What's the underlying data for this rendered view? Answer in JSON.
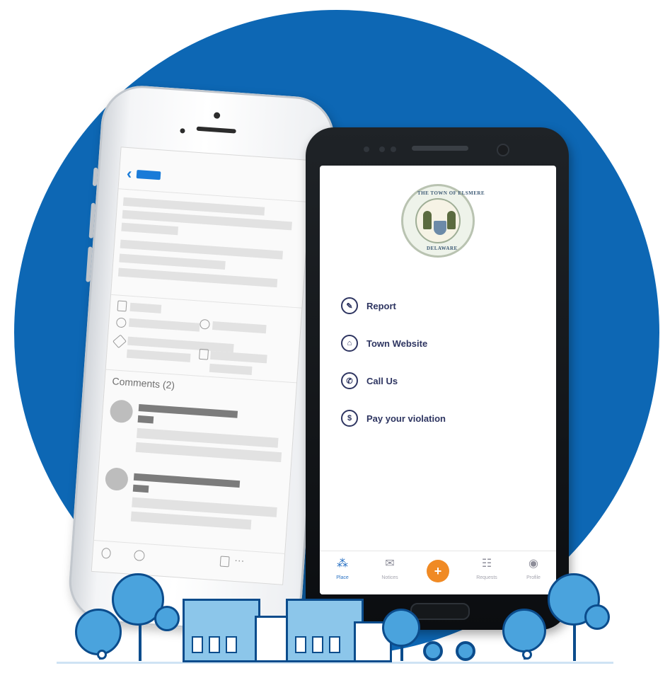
{
  "colors": {
    "background_circle": "#0d67b4",
    "accent_blue": "#2b73c4",
    "menu_text": "#2e3561",
    "fab_orange": "#f08a24"
  },
  "iphone": {
    "comments_label": "Comments (2)"
  },
  "android": {
    "seal": {
      "top_text": "THE TOWN OF ELSMERE",
      "bottom_text": "DELAWARE"
    },
    "menu": [
      {
        "icon": "edit-icon",
        "label": "Report"
      },
      {
        "icon": "building-icon",
        "label": "Town Website"
      },
      {
        "icon": "phone-icon",
        "label": "Call Us"
      },
      {
        "icon": "dollar-icon",
        "label": "Pay your violation"
      }
    ],
    "tabbar": [
      {
        "icon": "place-icon",
        "label": "Place",
        "active": true
      },
      {
        "icon": "mail-icon",
        "label": "Notices",
        "active": false
      },
      {
        "icon": "plus-icon",
        "label": "+",
        "active": false
      },
      {
        "icon": "list-icon",
        "label": "Requests",
        "active": false
      },
      {
        "icon": "profile-icon",
        "label": "Profile",
        "active": false
      }
    ]
  }
}
